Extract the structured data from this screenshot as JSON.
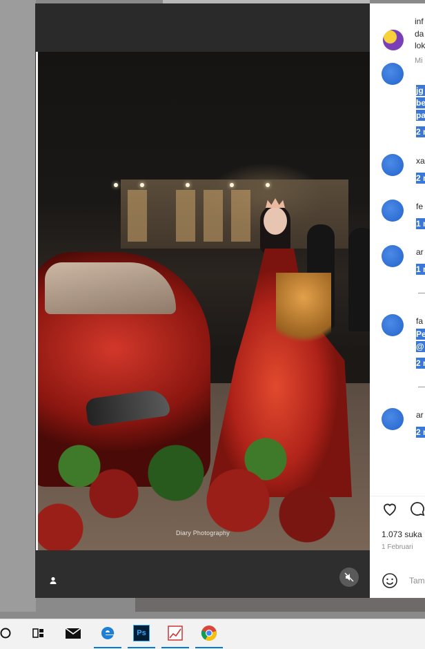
{
  "post": {
    "account_name": "inf",
    "account_line2": "da",
    "account_line3": "lok",
    "account_sub": "Mi",
    "watermark": "Diary Photography"
  },
  "comments": [
    {
      "highlighted_lines": [
        "jg",
        "be",
        "pa",
        "2 n"
      ]
    },
    {
      "name": "xa",
      "meta": "2 n"
    },
    {
      "name": "fe",
      "meta": "1 n"
    },
    {
      "name": "ar",
      "meta": "1 n"
    },
    {
      "name": "fa",
      "highlighted_lines": [
        "Pe",
        "@",
        "2 n"
      ]
    },
    {
      "name": "ar",
      "meta": "2 n"
    }
  ],
  "actions": {
    "likes": "1.073 suka",
    "date": "1 Februari",
    "comment_placeholder": "Tam"
  },
  "taskbar": {
    "items": [
      "cortana-icon",
      "task-view-icon",
      "mail-icon",
      "edge-icon",
      "photoshop-icon",
      "chart-app-icon",
      "chrome-icon"
    ],
    "ps_label": "Ps"
  },
  "colors": {
    "highlight": "#3a77d6",
    "accent": "#0078d7",
    "player_bg": "#2e2e2e"
  }
}
